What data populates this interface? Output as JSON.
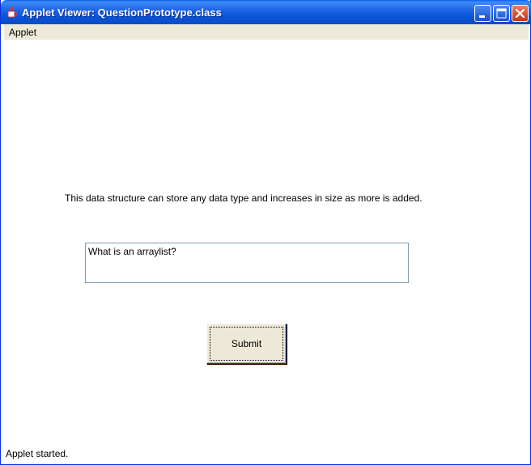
{
  "window": {
    "title": "Applet Viewer: QuestionPrototype.class",
    "title_icon": "java-coffee-icon",
    "controls": [
      "minimize-icon",
      "maximize-icon",
      "close-icon"
    ]
  },
  "menubar": {
    "items": [
      {
        "label": "Applet"
      }
    ]
  },
  "applet": {
    "question_text": "This data structure can store any data type and increases in size as more is added.",
    "answer_value": "What is an arraylist?",
    "submit_label": "Submit"
  },
  "status": {
    "text": "Applet started."
  },
  "colors": {
    "titlebar_blue": "#0a52d6",
    "menubar_bg": "#ece9d8",
    "field_border": "#7f9db9",
    "close_red": "#d9522f"
  }
}
